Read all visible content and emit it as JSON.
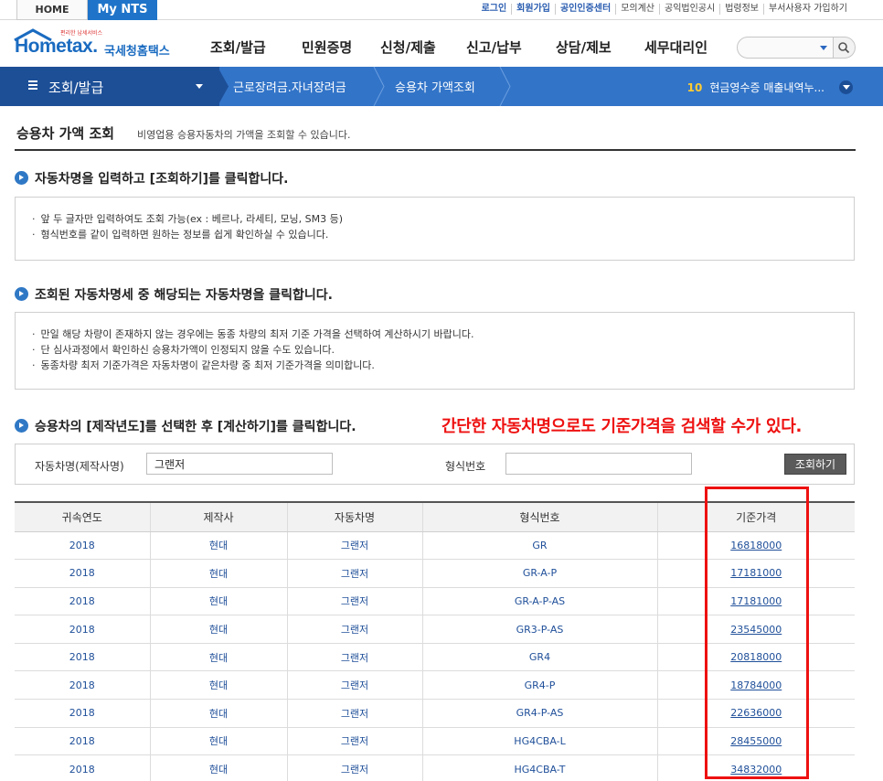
{
  "topbar": {
    "home": "HOME",
    "mynts": "My NTS",
    "links": [
      "로그인",
      "회원가입",
      "공인인증센터",
      "모의계산",
      "공익법인공시",
      "법령정보",
      "부서사용자 가입하기"
    ]
  },
  "header": {
    "logo_tagline": "편리한 납세서비스",
    "logo_word": "Hom​etax.",
    "logo_korean": "국세청홈택스",
    "gnb": [
      "조회/발급",
      "민원증명",
      "신청/제출",
      "신고/납부",
      "상담/제보",
      "세무대리인"
    ]
  },
  "navbar": {
    "menu_title": "조회/발급",
    "crumbs": [
      "근로장려금.자녀장려금",
      "승용차 가액조회"
    ],
    "right_num": "10",
    "right_text": "현금영수증 매출내역누..."
  },
  "page": {
    "title": "승용차 가액 조회",
    "desc": "비영업용 승용자동차의 가액을 조회할 수 있습니다."
  },
  "section1": {
    "title": "자동차명을 입력하고 [조회하기]를 클릭합니다.",
    "lines": [
      "앞 두 글자만 입력하여도 조회 가능(ex : 베르나, 라세티, 모닝, SM3 등)",
      "형식번호를 같이 입력하면 원하는 정보를 쉽게 확인하실 수 있습니다."
    ]
  },
  "section2": {
    "title": "조회된 자동차명세 중 해당되는 자동차명을 클릭합니다.",
    "lines": [
      "만일 해당 차량이 존재하지 않는 경우에는 동종 차량의 최저 기준 가격을 선택하여 계산하시기 바랍니다.",
      "단 심사과정에서 확인하신 승용차가액이 인정되지 않을 수도 있습니다.",
      "동종차량 최저 기준가격은 자동차명이 같은차량 중  최저 기준가격을 의미합니다."
    ]
  },
  "section3": {
    "title": "승용차의 [제작년도]를 선택한 후 [계산하기]를 클릭합니다."
  },
  "red_note": "간단한 자동차명으로도 기준가격을 검색할 수가 있다.",
  "form": {
    "car_name_label": "자동차명(제작사명)",
    "car_name_value": "그랜저",
    "model_no_label": "형식번호",
    "model_no_value": "",
    "search_button": "조회하기"
  },
  "table": {
    "headers": [
      "귀속연도",
      "제작사",
      "자동차명",
      "형식번호",
      "기준가격"
    ],
    "rows": [
      [
        "2018",
        "현대",
        "그랜저",
        "GR",
        "16818000"
      ],
      [
        "2018",
        "현대",
        "그랜저",
        "GR-A-P",
        "17181000"
      ],
      [
        "2018",
        "현대",
        "그랜저",
        "GR-A-P-AS",
        "17181000"
      ],
      [
        "2018",
        "현대",
        "그랜저",
        "GR3-P-AS",
        "23545000"
      ],
      [
        "2018",
        "현대",
        "그랜저",
        "GR4",
        "20818000"
      ],
      [
        "2018",
        "현대",
        "그랜저",
        "GR4-P",
        "18784000"
      ],
      [
        "2018",
        "현대",
        "그랜저",
        "GR4-P-AS",
        "22636000"
      ],
      [
        "2018",
        "현대",
        "그랜저",
        "HG4CBA-L",
        "28455000"
      ],
      [
        "2018",
        "현대",
        "그랜저",
        "HG4CBA-T",
        "34832000"
      ]
    ]
  },
  "colors": {
    "brand_blue": "#1a6bc0",
    "nav_blue": "#3274c8",
    "highlight_red": "#ee1111"
  }
}
